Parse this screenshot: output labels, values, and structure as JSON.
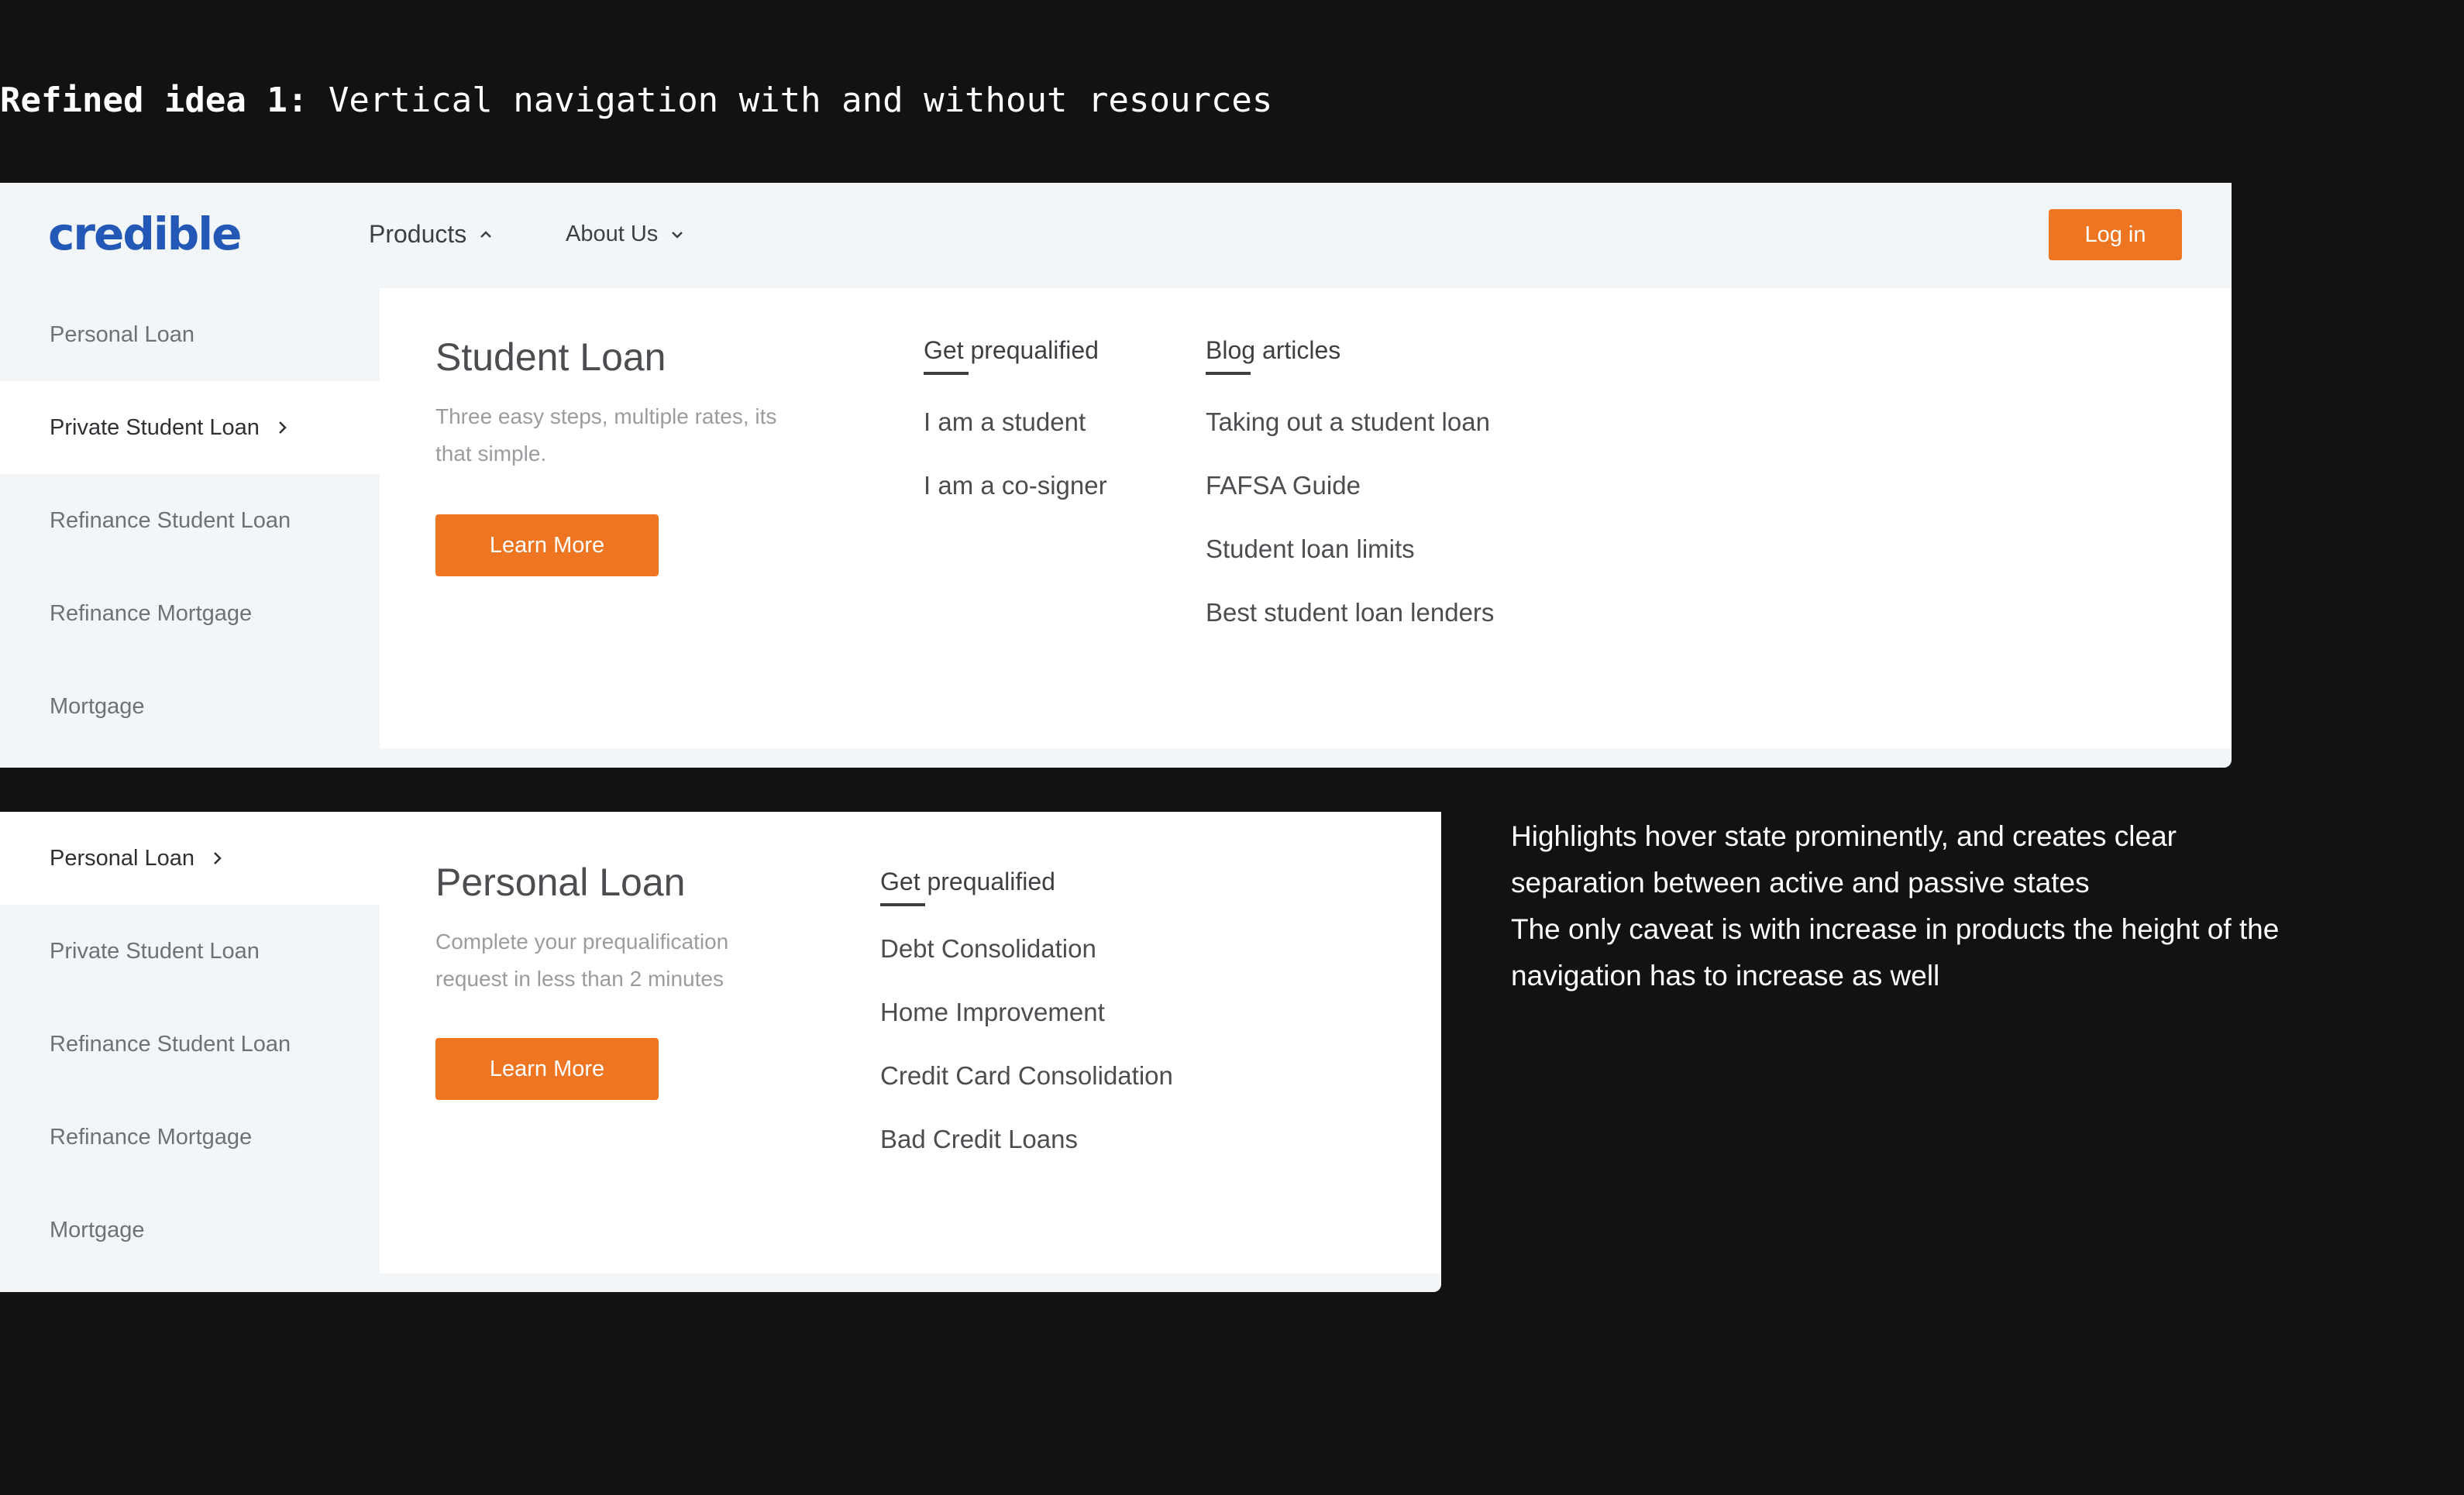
{
  "heading": {
    "bold": "Refined idea 1:",
    "text": "Vertical navigation with and without resources"
  },
  "header": {
    "logo": "credible",
    "nav": [
      {
        "label": "Products",
        "icon": "chevron-up-icon"
      },
      {
        "label": "About Us",
        "icon": "chevron-down-icon"
      }
    ],
    "login_label": "Log in"
  },
  "panel1": {
    "sidebar": [
      {
        "label": "Personal Loan"
      },
      {
        "label": "Private Student Loan",
        "active": true
      },
      {
        "label": "Refinance Student Loan"
      },
      {
        "label": "Refinance Mortgage"
      },
      {
        "label": "Mortgage"
      }
    ],
    "title": "Student Loan",
    "description": "Three easy steps, multiple rates, its that simple.",
    "cta": "Learn More",
    "col1": {
      "heading": "Get prequalified",
      "links": [
        "I am a student",
        "I am a co-signer"
      ]
    },
    "col2": {
      "heading": "Blog articles",
      "links": [
        "Taking out a student loan",
        "FAFSA Guide",
        "Student loan limits",
        "Best student loan lenders"
      ]
    }
  },
  "panel2": {
    "sidebar": [
      {
        "label": "Personal Loan",
        "active": true
      },
      {
        "label": "Private Student Loan"
      },
      {
        "label": "Refinance Student Loan"
      },
      {
        "label": "Refinance Mortgage"
      },
      {
        "label": "Mortgage"
      }
    ],
    "title": "Personal Loan",
    "description": "Complete your prequalification request in less than 2 minutes",
    "cta": "Learn More",
    "col1": {
      "heading": "Get prequalified",
      "links": [
        "Debt Consolidation",
        "Home Improvement",
        "Credit Card Consolidation",
        "Bad Credit Loans"
      ]
    }
  },
  "note": {
    "line1": "Highlights hover state prominently, and creates clear separation between active and passive states",
    "line2": "The only caveat is with increase in products the height of the navigation has to increase as well"
  },
  "colors": {
    "accent": "#ee7623",
    "brand": "#2358b6",
    "background": "#121212",
    "panel": "#f2f6f9"
  }
}
